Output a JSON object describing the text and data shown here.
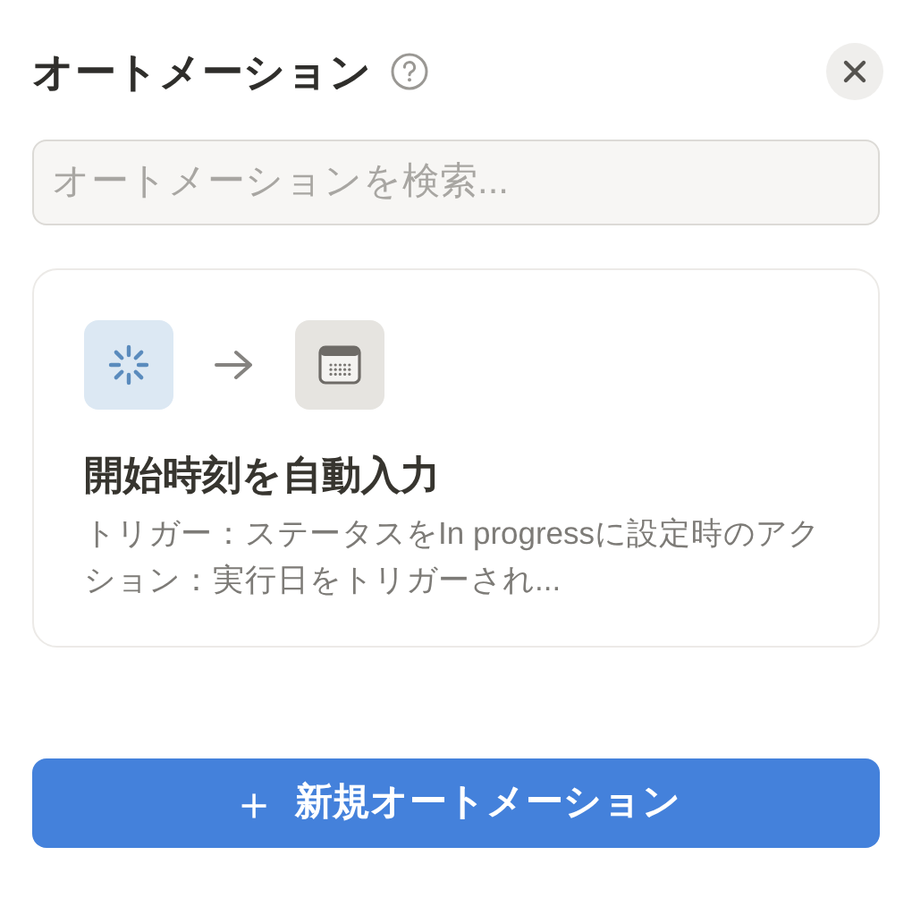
{
  "header": {
    "title": "オートメーション"
  },
  "search": {
    "placeholder": "オートメーションを検索..."
  },
  "automations": [
    {
      "title": "開始時刻を自動入力",
      "description": "トリガー：ステータスをIn progressに設定時のアクション：実行日をトリガーされ..."
    }
  ],
  "new_button": {
    "icon": "＋",
    "label": "新規オートメーション"
  }
}
